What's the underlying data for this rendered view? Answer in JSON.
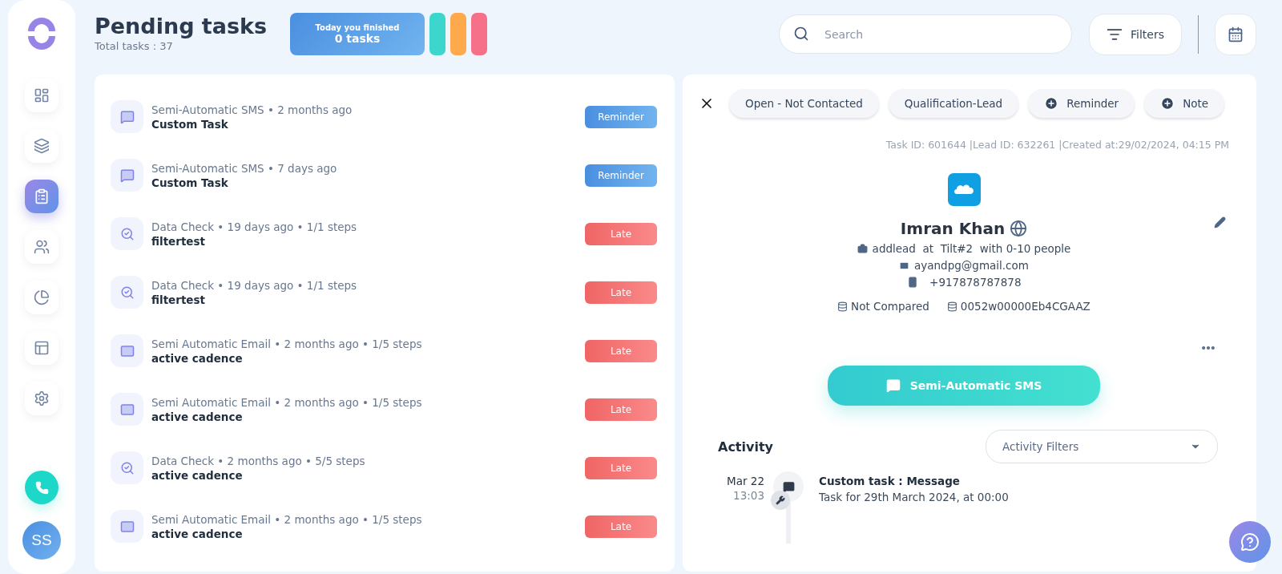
{
  "sidebar": {
    "nav": [
      {
        "kind": "dashboard",
        "selected": false
      },
      {
        "kind": "inbox",
        "selected": false
      },
      {
        "kind": "tasks",
        "selected": true
      },
      {
        "kind": "team",
        "selected": false
      },
      {
        "kind": "reports",
        "selected": false
      },
      {
        "kind": "templates",
        "selected": false
      },
      {
        "kind": "settings",
        "selected": false
      }
    ],
    "avatar": "SS"
  },
  "header": {
    "title": "Pending tasks",
    "subtitle": "Total tasks : 37",
    "finished": {
      "label": "Today you finished",
      "value": "0 tasks"
    },
    "color_tabs": [
      {
        "color": "#3dd6cc"
      },
      {
        "color": "#ffa94d"
      },
      {
        "color": "#f7708a"
      }
    ],
    "search": {
      "placeholder": "Search"
    },
    "filters_button": "Filters"
  },
  "tasks": [
    {
      "kind": "sms",
      "meta": "Semi-Automatic SMS • 2 months ago",
      "title": "Custom Task",
      "badge": {
        "kind": "reminder",
        "label": "Reminder"
      }
    },
    {
      "kind": "sms",
      "meta": "Semi-Automatic SMS • 7 days ago",
      "title": "Custom Task",
      "badge": {
        "kind": "reminder",
        "label": "Reminder"
      }
    },
    {
      "kind": "data-check",
      "meta": "Data Check • 19 days ago • 1/1 steps",
      "title": "filtertest",
      "badge": {
        "kind": "late",
        "label": "Late"
      }
    },
    {
      "kind": "data-check",
      "meta": "Data Check • 19 days ago • 1/1 steps",
      "title": "filtertest",
      "badge": {
        "kind": "late",
        "label": "Late"
      }
    },
    {
      "kind": "email",
      "meta": "Semi Automatic Email • 2 months ago • 1/5 steps",
      "title": "active cadence",
      "badge": {
        "kind": "late",
        "label": "Late"
      }
    },
    {
      "kind": "email",
      "meta": "Semi Automatic Email • 2 months ago • 1/5 steps",
      "title": "active cadence",
      "badge": {
        "kind": "late",
        "label": "Late"
      }
    },
    {
      "kind": "data-check",
      "meta": "Data Check • 2 months ago • 5/5 steps",
      "title": "active cadence",
      "badge": {
        "kind": "late",
        "label": "Late"
      }
    },
    {
      "kind": "email",
      "meta": "Semi Automatic Email • 2 months ago • 1/5 steps",
      "title": "active cadence",
      "badge": {
        "kind": "late",
        "label": "Late"
      }
    }
  ],
  "detail": {
    "chips": [
      {
        "kind": "plain",
        "label": "Open - Not Contacted"
      },
      {
        "kind": "plain",
        "label": "Qualification-Lead"
      },
      {
        "kind": "add",
        "label": "Reminder"
      },
      {
        "kind": "add",
        "label": "Note"
      }
    ],
    "meta": "Task ID: 601644 |Lead ID: 632261 |Created at:29/02/2024, 04:15 PM",
    "lead": {
      "name": "Imran Khan",
      "company": "addlead  at  Tilt#2  with 0-10 people",
      "email": "ayandpg@gmail.com",
      "phone": "+917878787878",
      "compare": "Not Compared",
      "crm_id": "0052w00000Eb4CGAAZ"
    },
    "action_button": "Semi-Automatic SMS",
    "activity": {
      "title": "Activity",
      "filter_placeholder": "Activity Filters",
      "entries": [
        {
          "date": "Mar 22",
          "time": "13:03",
          "title": "Custom task : Message",
          "text": "Task for 29th March 2024, at 00:00"
        }
      ]
    }
  }
}
